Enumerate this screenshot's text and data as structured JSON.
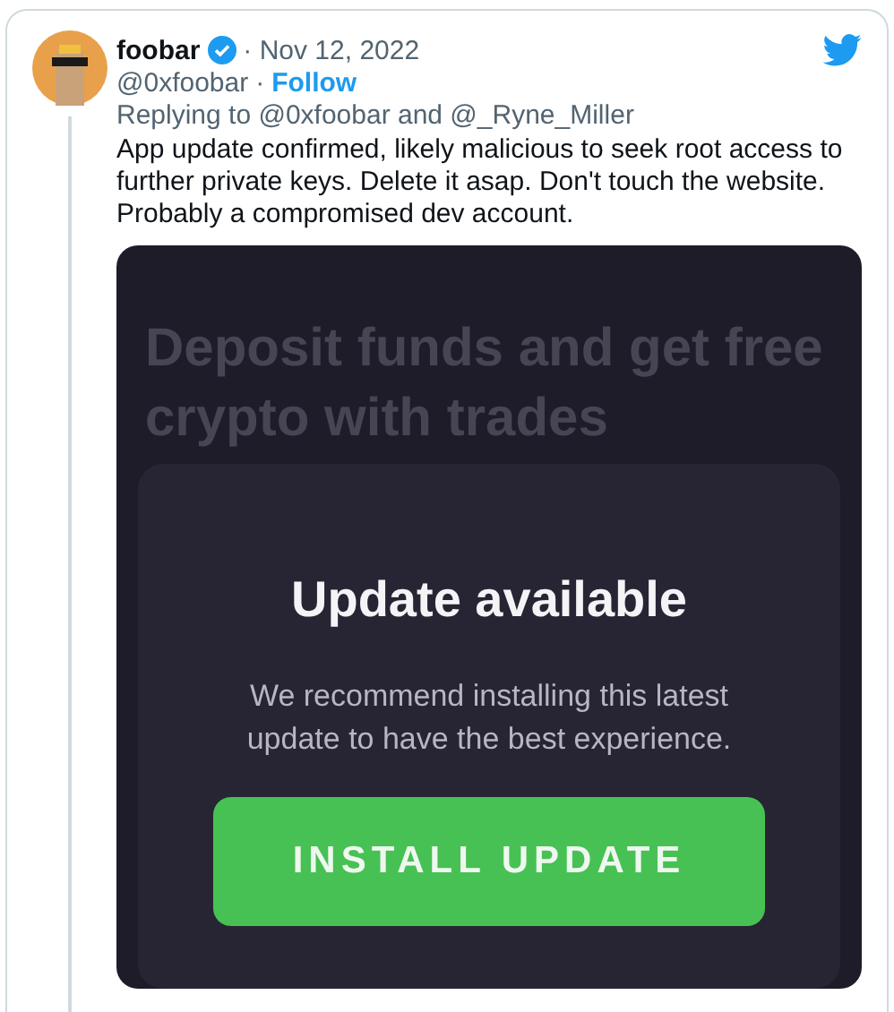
{
  "tweet": {
    "author": {
      "name": "foobar",
      "verified": true,
      "handle": "@0xfoobar"
    },
    "date": "· Nov 12, 2022",
    "separator": "·",
    "follow": "Follow",
    "replying_to": "Replying to @0xfoobar and @_Ryne_Miller",
    "text": "App update confirmed, likely malicious to seek root access to further private keys. Delete it asap. Don't touch the website. Probably a compromised dev account.",
    "media": {
      "headline": "Deposit funds and get free crypto with trades",
      "dialog": {
        "title": "Update available",
        "message": "We recommend installing this latest update to have the best experience.",
        "button": "INSTALL UPDATE"
      }
    }
  }
}
